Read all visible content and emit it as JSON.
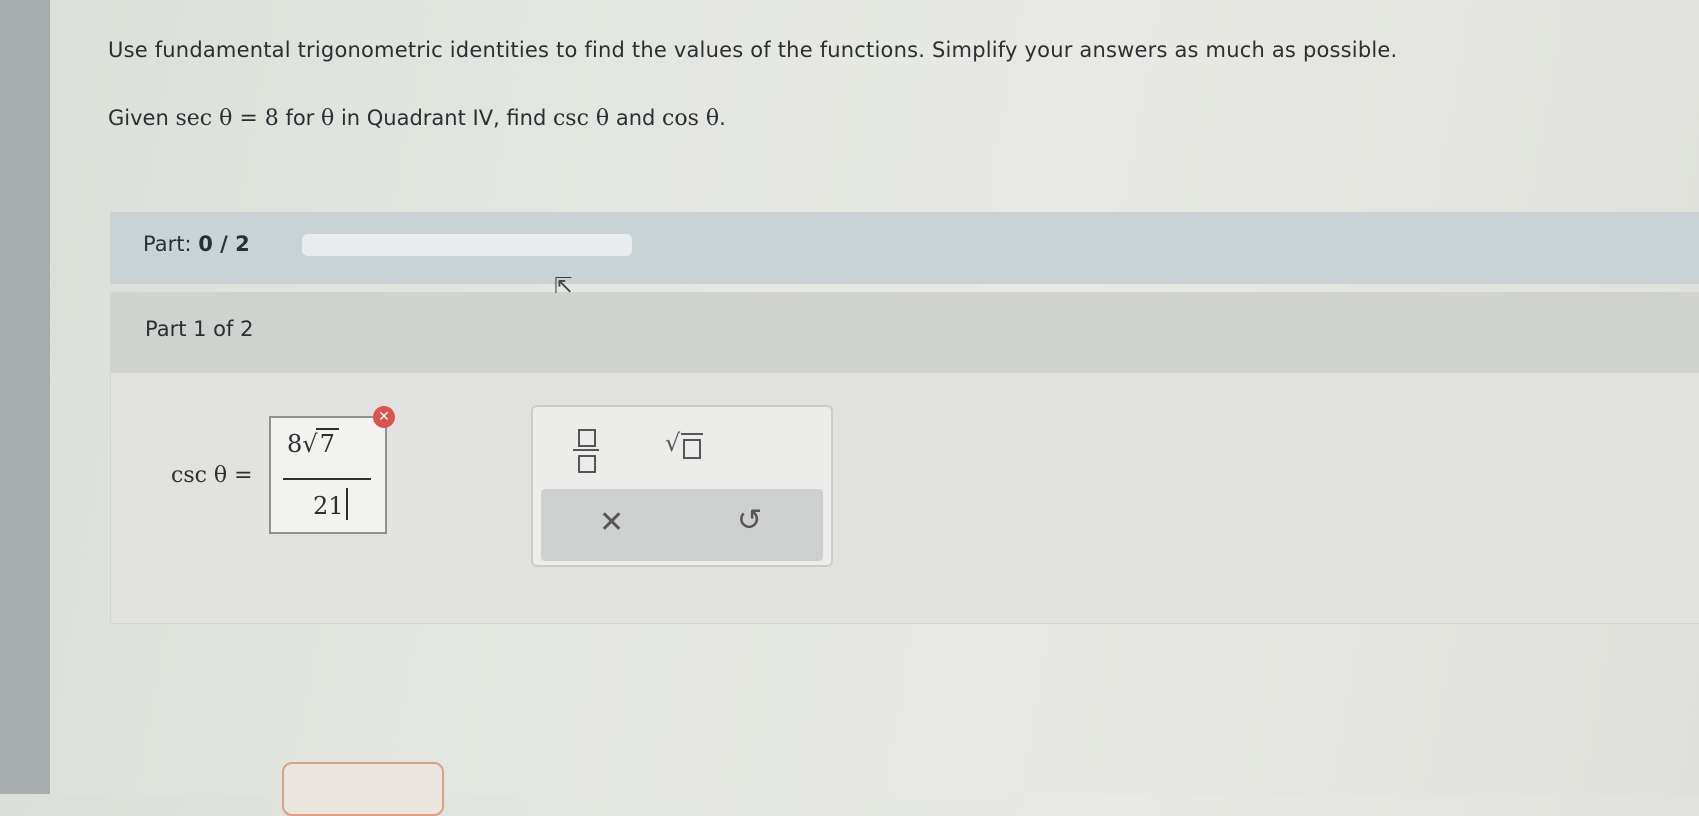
{
  "question": {
    "instructions": "Use fundamental trigonometric identities to find the values of the functions. Simplify your answers as much as possible.",
    "given_prefix": "Given",
    "given_expr": "sec θ = 8",
    "given_for": "for",
    "theta": "θ",
    "given_in": "in Quadrant IV, find",
    "csc_expr": "csc θ",
    "and": "and",
    "cos_expr": "cos θ",
    "period": "."
  },
  "progress": {
    "label": "Part:",
    "value": "0 / 2",
    "fraction": 0.0
  },
  "part": {
    "title": "Part 1 of 2",
    "equation_label": "csc θ =",
    "answer": {
      "coefficient": "8",
      "radical_sign": "√",
      "radicand": "7",
      "denominator": "21"
    },
    "error_icon": "x-circle-icon"
  },
  "toolbox": {
    "fraction_tool": "fraction-icon",
    "sqrt_tool": "sqrt-icon",
    "sqrt_symbol": "√",
    "clear_symbol": "✕",
    "undo_symbol": "↺"
  },
  "colors": {
    "error": "#d9534f",
    "progress_fill": "#5a8fb4"
  }
}
